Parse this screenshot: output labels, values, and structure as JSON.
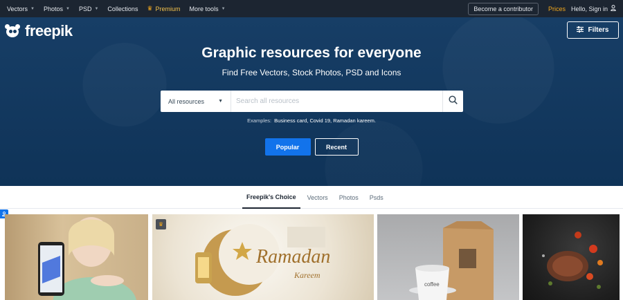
{
  "topbar": {
    "nav": [
      {
        "label": "Vectors",
        "caret": true
      },
      {
        "label": "Photos",
        "caret": true
      },
      {
        "label": "PSD",
        "caret": true
      },
      {
        "label": "Collections",
        "caret": false
      },
      {
        "label": "Premium",
        "caret": false
      },
      {
        "label": "More tools",
        "caret": true
      }
    ],
    "contributor_label": "Become a contributor",
    "prices_label": "Prices",
    "signin_label": "Hello, Sign in"
  },
  "header": {
    "logo_text": "freepik",
    "filters_label": "Filters"
  },
  "hero": {
    "title": "Graphic resources for everyone",
    "subtitle": "Find Free Vectors, Stock Photos, PSD and Icons",
    "search": {
      "select_value": "All resources",
      "placeholder": "Search all resources",
      "value": ""
    },
    "examples_label": "Examples:",
    "examples": "Business card, Covid 19, Ramadan kareem.",
    "popular_label": "Popular",
    "recent_label": "Recent"
  },
  "tabs": [
    "Freepik's Choice",
    "Vectors",
    "Photos",
    "Psds"
  ],
  "colors": {
    "topbar": "#1c2531",
    "hero": "#143a5f",
    "accent": "#1273eb",
    "premium": "#f3a81c"
  }
}
